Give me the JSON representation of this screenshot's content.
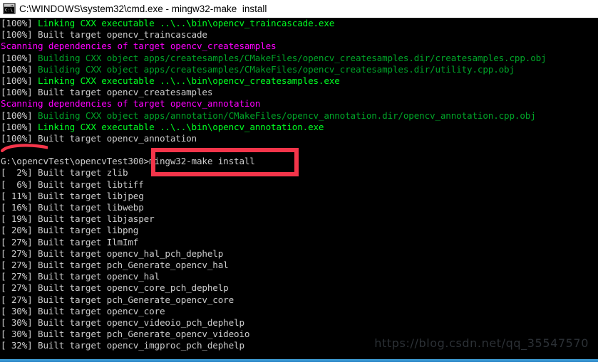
{
  "window": {
    "title": "C:\\WINDOWS\\system32\\cmd.exe - mingw32-make  install",
    "icon": "cmd-console-icon",
    "titlebar_bg": "#ffffff",
    "titlebar_fg": "#000000",
    "console_bg": "#000000",
    "bottom_border_color": "#2a87c8"
  },
  "colors": {
    "default_text": "#cccccc",
    "bright_green": "#00ff22",
    "dark_green": "#00a428",
    "magenta": "#ff00ff",
    "annotation_red": "#f4354a",
    "watermark": "#2c3136"
  },
  "terminal": {
    "prompt_path": "G:\\opencvTest\\opencvTest300",
    "prompt_symbol": ">",
    "command": "mingw32-make install",
    "lines": [
      {
        "segments": [
          {
            "text": "[100%] ",
            "color": "white"
          },
          {
            "text": "Linking CXX executable ..\\..\\bin\\opencv_traincascade.exe",
            "color": "brgreen"
          }
        ]
      },
      {
        "segments": [
          {
            "text": "[100%] Built target opencv_traincascade",
            "color": "white"
          }
        ]
      },
      {
        "segments": [
          {
            "text": "Scanning dependencies of target opencv_createsamples",
            "color": "magenta"
          }
        ]
      },
      {
        "segments": [
          {
            "text": "[100%] ",
            "color": "white"
          },
          {
            "text": "Building CXX object apps/createsamples/CMakeFiles/opencv_createsamples.dir/createsamples.cpp.obj",
            "color": "green"
          }
        ]
      },
      {
        "segments": [
          {
            "text": "[100%] ",
            "color": "white"
          },
          {
            "text": "Building CXX object apps/createsamples/CMakeFiles/opencv_createsamples.dir/utility.cpp.obj",
            "color": "green"
          }
        ]
      },
      {
        "segments": [
          {
            "text": "[100%] ",
            "color": "white"
          },
          {
            "text": "Linking CXX executable ..\\..\\bin\\opencv_createsamples.exe",
            "color": "brgreen"
          }
        ]
      },
      {
        "segments": [
          {
            "text": "[100%] Built target opencv_createsamples",
            "color": "white"
          }
        ]
      },
      {
        "segments": [
          {
            "text": "Scanning dependencies of target opencv_annotation",
            "color": "magenta"
          }
        ]
      },
      {
        "segments": [
          {
            "text": "[100%] ",
            "color": "white"
          },
          {
            "text": "Building CXX object apps/annotation/CMakeFiles/opencv_annotation.dir/opencv_annotation.cpp.obj",
            "color": "green"
          }
        ]
      },
      {
        "segments": [
          {
            "text": "[100%] ",
            "color": "white"
          },
          {
            "text": "Linking CXX executable ..\\..\\bin\\opencv_annotation.exe",
            "color": "brgreen"
          }
        ]
      },
      {
        "segments": [
          {
            "text": "[100%] Built target opencv_annotation",
            "color": "white"
          }
        ]
      },
      {
        "segments": [
          {
            "text": "",
            "color": "white"
          }
        ]
      },
      {
        "segments": [
          {
            "text": "G:\\opencvTest\\opencvTest300>mingw32-make install",
            "color": "white"
          }
        ]
      },
      {
        "segments": [
          {
            "text": "[  2%] Built target zlib",
            "color": "white"
          }
        ]
      },
      {
        "segments": [
          {
            "text": "[  6%] Built target libtiff",
            "color": "white"
          }
        ]
      },
      {
        "segments": [
          {
            "text": "[ 11%] Built target libjpeg",
            "color": "white"
          }
        ]
      },
      {
        "segments": [
          {
            "text": "[ 16%] Built target libwebp",
            "color": "white"
          }
        ]
      },
      {
        "segments": [
          {
            "text": "[ 19%] Built target libjasper",
            "color": "white"
          }
        ]
      },
      {
        "segments": [
          {
            "text": "[ 20%] Built target libpng",
            "color": "white"
          }
        ]
      },
      {
        "segments": [
          {
            "text": "[ 27%] Built target IlmImf",
            "color": "white"
          }
        ]
      },
      {
        "segments": [
          {
            "text": "[ 27%] Built target opencv_hal_pch_dephelp",
            "color": "white"
          }
        ]
      },
      {
        "segments": [
          {
            "text": "[ 27%] Built target pch_Generate_opencv_hal",
            "color": "white"
          }
        ]
      },
      {
        "segments": [
          {
            "text": "[ 27%] Built target opencv_hal",
            "color": "white"
          }
        ]
      },
      {
        "segments": [
          {
            "text": "[ 27%] Built target opencv_core_pch_dephelp",
            "color": "white"
          }
        ]
      },
      {
        "segments": [
          {
            "text": "[ 27%] Built target pch_Generate_opencv_core",
            "color": "white"
          }
        ]
      },
      {
        "segments": [
          {
            "text": "[ 30%] Built target opencv_core",
            "color": "white"
          }
        ]
      },
      {
        "segments": [
          {
            "text": "[ 30%] Built target opencv_videoio_pch_dephelp",
            "color": "white"
          }
        ]
      },
      {
        "segments": [
          {
            "text": "[ 30%] Built target pch_Generate_opencv_videoio",
            "color": "white"
          }
        ]
      },
      {
        "segments": [
          {
            "text": "[ 32%] Built target opencv_imgproc_pch_dephelp",
            "color": "white"
          }
        ]
      }
    ]
  },
  "annotations": {
    "command_highlight_box": {
      "label": "mingw32-make install",
      "color": "#f4354a"
    },
    "underline_stroke": {
      "label": "[100%]",
      "color": "#f4354a"
    }
  },
  "watermark": {
    "text": "https://blog.csdn.net/qq_35547570"
  }
}
